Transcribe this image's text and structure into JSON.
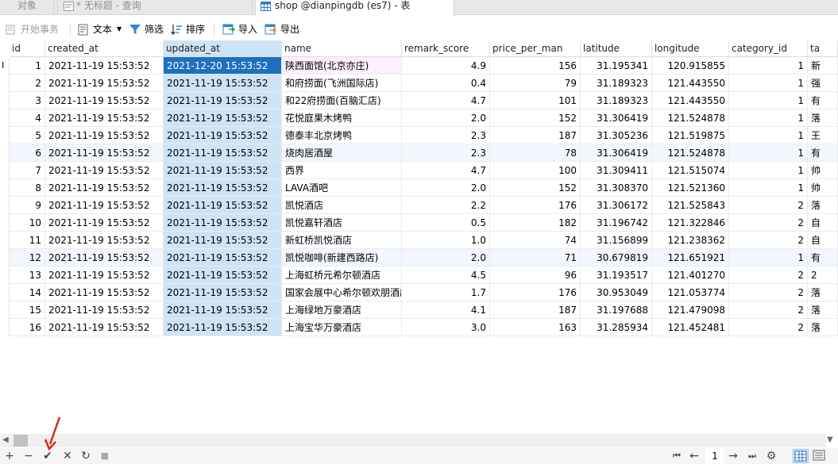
{
  "tabs": {
    "objects": "对象",
    "query": "* 无标题 - 查询",
    "table": "shop @dianpingdb (es7) - 表"
  },
  "toolbar": {
    "begin_transaction": "开始事务",
    "text": "文本",
    "filter": "筛选",
    "sort": "排序",
    "import": "导入",
    "export": "导出"
  },
  "columns": [
    "id",
    "created_at",
    "updated_at",
    "name",
    "remark_score",
    "price_per_man",
    "latitude",
    "longitude",
    "category_id",
    "ta"
  ],
  "selected_column": "updated_at",
  "rows": [
    {
      "id": "1",
      "created_at": "2021-11-19 15:53:52",
      "updated_at": "2021-12-20 15:53:52",
      "name": "陕西面馆(北京亦庄)",
      "remark_score": "4.9",
      "price_per_man": "156",
      "latitude": "31.195341",
      "longitude": "120.915855",
      "category_id": "1",
      "ta": "新"
    },
    {
      "id": "2",
      "created_at": "2021-11-19 15:53:52",
      "updated_at": "2021-11-19 15:53:52",
      "name": "和府捞面(飞洲国际店)",
      "remark_score": "0.4",
      "price_per_man": "79",
      "latitude": "31.189323",
      "longitude": "121.443550",
      "category_id": "1",
      "ta": "强"
    },
    {
      "id": "3",
      "created_at": "2021-11-19 15:53:52",
      "updated_at": "2021-11-19 15:53:52",
      "name": "和22府捞面(百脑汇店)",
      "remark_score": "4.7",
      "price_per_man": "101",
      "latitude": "31.189323",
      "longitude": "121.443550",
      "category_id": "1",
      "ta": "有"
    },
    {
      "id": "4",
      "created_at": "2021-11-19 15:53:52",
      "updated_at": "2021-11-19 15:53:52",
      "name": "花悦庭果木烤鸭",
      "remark_score": "2.0",
      "price_per_man": "152",
      "latitude": "31.306419",
      "longitude": "121.524878",
      "category_id": "1",
      "ta": "落"
    },
    {
      "id": "5",
      "created_at": "2021-11-19 15:53:52",
      "updated_at": "2021-11-19 15:53:52",
      "name": "德泰丰北京烤鸭",
      "remark_score": "2.3",
      "price_per_man": "187",
      "latitude": "31.305236",
      "longitude": "121.519875",
      "category_id": "1",
      "ta": "王"
    },
    {
      "id": "6",
      "created_at": "2021-11-19 15:53:52",
      "updated_at": "2021-11-19 15:53:52",
      "name": "烧肉居酒屋",
      "remark_score": "2.3",
      "price_per_man": "78",
      "latitude": "31.306419",
      "longitude": "121.524878",
      "category_id": "1",
      "ta": "有"
    },
    {
      "id": "7",
      "created_at": "2021-11-19 15:53:52",
      "updated_at": "2021-11-19 15:53:52",
      "name": "西界",
      "remark_score": "4.7",
      "price_per_man": "100",
      "latitude": "31.309411",
      "longitude": "121.515074",
      "category_id": "1",
      "ta": "帅"
    },
    {
      "id": "8",
      "created_at": "2021-11-19 15:53:52",
      "updated_at": "2021-11-19 15:53:52",
      "name": "LAVA酒吧",
      "remark_score": "2.0",
      "price_per_man": "152",
      "latitude": "31.308370",
      "longitude": "121.521360",
      "category_id": "1",
      "ta": "帅"
    },
    {
      "id": "9",
      "created_at": "2021-11-19 15:53:52",
      "updated_at": "2021-11-19 15:53:52",
      "name": "凯悦酒店",
      "remark_score": "2.2",
      "price_per_man": "176",
      "latitude": "31.306172",
      "longitude": "121.525843",
      "category_id": "2",
      "ta": "落"
    },
    {
      "id": "10",
      "created_at": "2021-11-19 15:53:52",
      "updated_at": "2021-11-19 15:53:52",
      "name": "凯悦嘉轩酒店",
      "remark_score": "0.5",
      "price_per_man": "182",
      "latitude": "31.196742",
      "longitude": "121.322846",
      "category_id": "2",
      "ta": "自"
    },
    {
      "id": "11",
      "created_at": "2021-11-19 15:53:52",
      "updated_at": "2021-11-19 15:53:52",
      "name": "新虹桥凯悦酒店",
      "remark_score": "1.0",
      "price_per_man": "74",
      "latitude": "31.156899",
      "longitude": "121.238362",
      "category_id": "2",
      "ta": "自"
    },
    {
      "id": "12",
      "created_at": "2021-11-19 15:53:52",
      "updated_at": "2021-11-19 15:53:52",
      "name": "凯悦咖啡(新建西路店)",
      "remark_score": "2.0",
      "price_per_man": "71",
      "latitude": "30.679819",
      "longitude": "121.651921",
      "category_id": "1",
      "ta": "有"
    },
    {
      "id": "13",
      "created_at": "2021-11-19 15:53:52",
      "updated_at": "2021-11-19 15:53:52",
      "name": "上海虹桥元希尔顿酒店",
      "remark_score": "4.5",
      "price_per_man": "96",
      "latitude": "31.193517",
      "longitude": "121.401270",
      "category_id": "2",
      "ta": "2"
    },
    {
      "id": "14",
      "created_at": "2021-11-19 15:53:52",
      "updated_at": "2021-11-19 15:53:52",
      "name": "国家会展中心希尔顿欢朋酒店",
      "remark_score": "1.7",
      "price_per_man": "176",
      "latitude": "30.953049",
      "longitude": "121.053774",
      "category_id": "2",
      "ta": "落"
    },
    {
      "id": "15",
      "created_at": "2021-11-19 15:53:52",
      "updated_at": "2021-11-19 15:53:52",
      "name": "上海绿地万豪酒店",
      "remark_score": "4.1",
      "price_per_man": "187",
      "latitude": "31.197688",
      "longitude": "121.479098",
      "category_id": "2",
      "ta": "落"
    },
    {
      "id": "16",
      "created_at": "2021-11-19 15:53:52",
      "updated_at": "2021-11-19 15:53:52",
      "name": "上海宝华万豪酒店",
      "remark_score": "3.0",
      "price_per_man": "163",
      "latitude": "31.285934",
      "longitude": "121.452481",
      "category_id": "2",
      "ta": "落"
    }
  ],
  "pager": {
    "page": "1"
  },
  "colors": {
    "accent": "#1f6fbf",
    "selected_header": "#cde4f7",
    "arrow": "#e0261c"
  },
  "icons": {
    "row_cursor": "I"
  }
}
